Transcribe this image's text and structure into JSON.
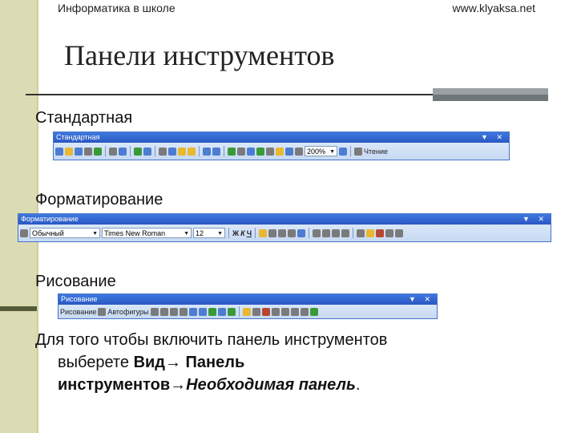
{
  "header": {
    "left": "Информатика в школе",
    "right": "www.klyaksa.net"
  },
  "title": "Панели инструментов",
  "sections": {
    "standard": {
      "label": "Стандартная",
      "toolbar_title": "Стандартная",
      "zoom": "200%",
      "reading": "Чтение",
      "icons": [
        "new-doc",
        "open",
        "save",
        "permission",
        "email",
        "print",
        "print-preview",
        "spelling",
        "research",
        "cut",
        "copy",
        "paste",
        "format-painter",
        "undo",
        "redo",
        "hyperlink",
        "tables-borders",
        "insert-table",
        "insert-excel",
        "columns",
        "drawing",
        "document-map",
        "show-hide",
        "zoom",
        "help",
        "read"
      ]
    },
    "formatting": {
      "label": "Форматирование",
      "toolbar_title": "Форматирование",
      "style": "Обычный",
      "font": "Times New Roman",
      "size": "12",
      "buttons": {
        "bold": "Ж",
        "italic": "К",
        "underline": "Ч"
      }
    },
    "drawing": {
      "label": "Рисование",
      "toolbar_title": "Рисование",
      "draw_menu": "Рисование",
      "autoshapes": "Автофигуры"
    }
  },
  "instruction": {
    "line1": "Для того чтобы включить панель инструментов",
    "line2_prefix": "выберете ",
    "line2_bold": "Вид→ Панель",
    "line3_bold": "инструментов→",
    "line3_bolditalic": "Необходимая панель",
    "line3_end": "."
  },
  "colors": {
    "accent_band": "#dcdcb4",
    "toolbar_title": "#2a57c2",
    "rule": "#333333"
  }
}
